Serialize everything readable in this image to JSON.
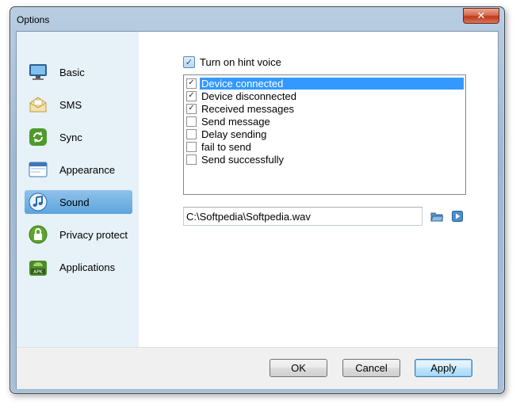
{
  "window": {
    "title": "Options",
    "close_label": "✕"
  },
  "sidebar": {
    "items": [
      {
        "label": "Basic",
        "icon": "monitor-icon",
        "selected": false
      },
      {
        "label": "SMS",
        "icon": "envelope-icon",
        "selected": false
      },
      {
        "label": "Sync",
        "icon": "sync-icon",
        "selected": false
      },
      {
        "label": "Appearance",
        "icon": "window-icon",
        "selected": false
      },
      {
        "label": "Sound",
        "icon": "music-note-icon",
        "selected": true
      },
      {
        "label": "Privacy protect",
        "icon": "lock-shield-icon",
        "selected": false
      },
      {
        "label": "Applications",
        "icon": "apk-icon",
        "selected": false
      }
    ]
  },
  "sound": {
    "hint_voice_label": "Turn on hint voice",
    "hint_voice_checked": true,
    "events": [
      {
        "label": "Device connected",
        "checked": true,
        "selected": true
      },
      {
        "label": "Device disconnected",
        "checked": true,
        "selected": false
      },
      {
        "label": "Received messages",
        "checked": true,
        "selected": false
      },
      {
        "label": "Send message",
        "checked": false,
        "selected": false
      },
      {
        "label": "Delay sending",
        "checked": false,
        "selected": false
      },
      {
        "label": "fail to send",
        "checked": false,
        "selected": false
      },
      {
        "label": "Send successfully",
        "checked": false,
        "selected": false
      }
    ],
    "sound_file": "C:\\Softpedia\\Softpedia.wav"
  },
  "footer": {
    "ok_label": "OK",
    "cancel_label": "Cancel",
    "apply_label": "Apply"
  },
  "colors": {
    "selection": "#3399ff",
    "sidebar_bg": "#e6f1f8",
    "nav_selected": "#5da4dc"
  }
}
